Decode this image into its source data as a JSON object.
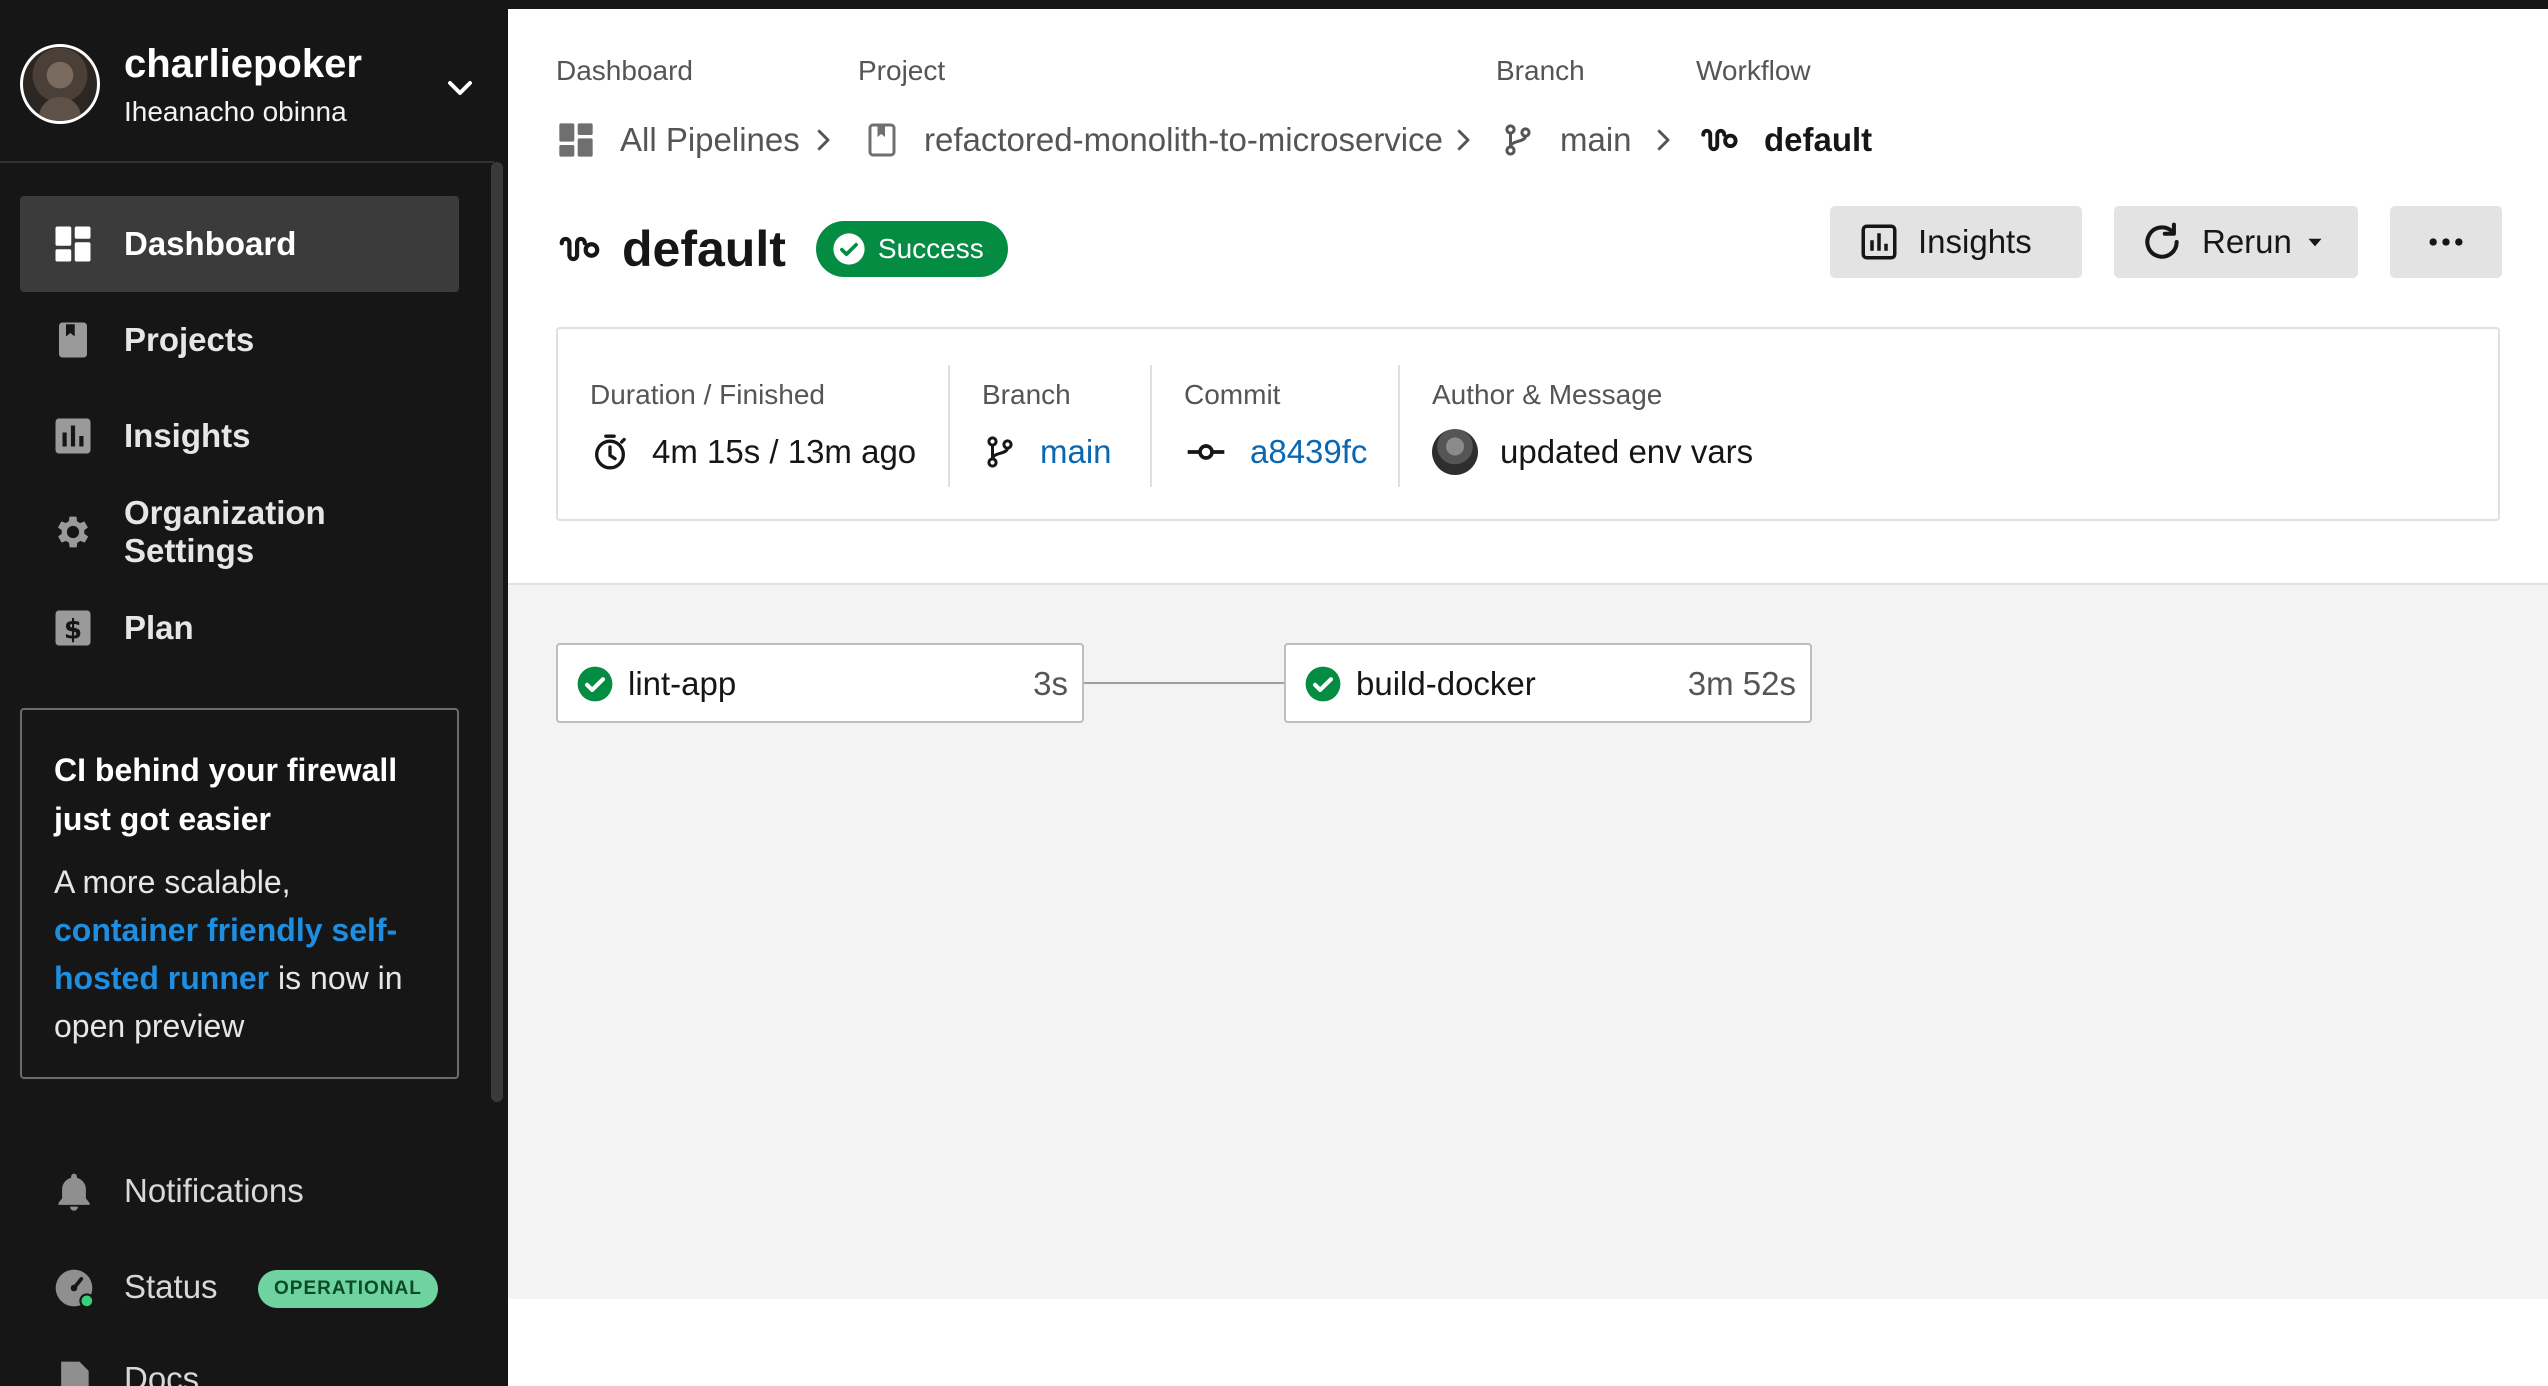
{
  "account": {
    "username": "charliepoker",
    "org_name": "Iheanacho obinna"
  },
  "sidebar": {
    "items": [
      {
        "label": "Dashboard",
        "icon": "dashboard-icon",
        "active": true
      },
      {
        "label": "Projects",
        "icon": "project-icon",
        "active": false
      },
      {
        "label": "Insights",
        "icon": "insights-icon",
        "active": false
      },
      {
        "label": "Organization Settings",
        "icon": "gear-icon",
        "active": false
      },
      {
        "label": "Plan",
        "icon": "dollar-icon",
        "active": false
      }
    ],
    "promo": {
      "title": "CI behind your firewall just got easier",
      "body_prefix": "A more scalable,",
      "link_text": "container friendly self-hosted runner",
      "body_suffix": "is now in open preview"
    },
    "bottom": {
      "notifications_label": "Notifications",
      "status_label": "Status",
      "status_badge": "OPERATIONAL",
      "docs_label": "Docs"
    }
  },
  "breadcrumb": {
    "dashboard_label": "Dashboard",
    "dashboard_value": "All Pipelines",
    "project_label": "Project",
    "project_value": "refactored-monolith-to-microservice",
    "branch_label": "Branch",
    "branch_value": "main",
    "workflow_label": "Workflow",
    "workflow_value": "default"
  },
  "header": {
    "title": "default",
    "status": "Success",
    "insights_button": "Insights",
    "rerun_button": "Rerun"
  },
  "meta": {
    "duration_label": "Duration / Finished",
    "duration_value": "4m 15s / 13m ago",
    "branch_label": "Branch",
    "branch_value": "main",
    "commit_label": "Commit",
    "commit_value": "a8439fc",
    "author_label": "Author & Message",
    "author_message": "updated env vars"
  },
  "jobs": [
    {
      "name": "lint-app",
      "duration": "3s",
      "status": "success"
    },
    {
      "name": "build-docker",
      "duration": "3m 52s",
      "status": "success"
    }
  ],
  "colors": {
    "success": "#048c43",
    "link": "#0a68b3",
    "sidebar_bg": "#161616",
    "promo_link": "#1f8ee0",
    "operational_badge": "#6fd3a0"
  }
}
